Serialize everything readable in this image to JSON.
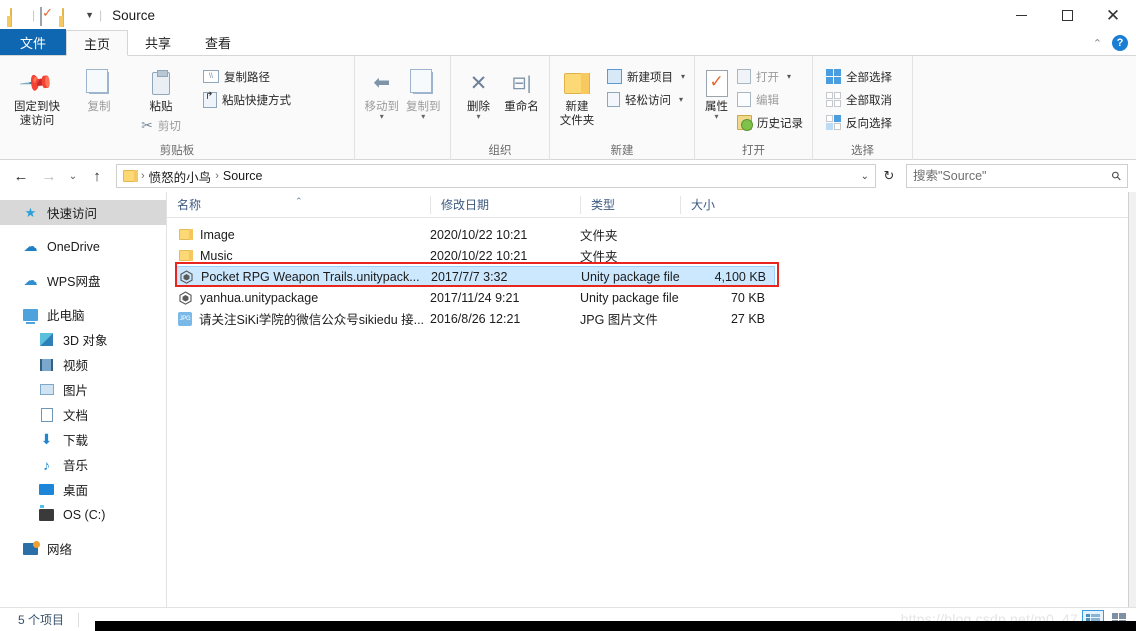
{
  "window": {
    "title": "Source",
    "quick_access": [
      "folder-icon",
      "properties-icon",
      "new-folder-icon",
      "customize-caret"
    ],
    "controls": {
      "minimize": "—",
      "maximize": "□",
      "close": "✕"
    }
  },
  "tabs": [
    {
      "id": "file",
      "label": "文件"
    },
    {
      "id": "home",
      "label": "主页"
    },
    {
      "id": "share",
      "label": "共享"
    },
    {
      "id": "view",
      "label": "查看"
    }
  ],
  "tab_right": {
    "collapse": "⌃",
    "help": "?"
  },
  "ribbon": {
    "groups": [
      {
        "label": "剪贴板",
        "big": [
          {
            "label": "固定到快\n速访问",
            "icon": "pin-icon"
          },
          {
            "label": "复制",
            "icon": "copy-icon"
          },
          {
            "label": "粘贴",
            "icon": "paste-icon"
          }
        ],
        "cut_label": "剪切",
        "small": [
          {
            "label": "复制路径",
            "icon": "copy-path-icon"
          },
          {
            "label": "粘贴快捷方式",
            "icon": "paste-shortcut-icon"
          }
        ]
      },
      {
        "label": "组织",
        "big": [
          {
            "label": "移动到",
            "icon": "move-to-icon"
          },
          {
            "label": "复制到",
            "icon": "copy-to-icon"
          },
          {
            "label": "删除",
            "icon": "delete-icon"
          },
          {
            "label": "重命名",
            "icon": "rename-icon"
          }
        ]
      },
      {
        "label": "新建",
        "big": [
          {
            "label": "新建\n文件夹",
            "icon": "new-folder-icon"
          }
        ],
        "small": [
          {
            "label": "新建项目",
            "icon": "new-item-icon",
            "caret": "▾"
          },
          {
            "label": "轻松访问",
            "icon": "easy-access-icon",
            "caret": "▾"
          }
        ]
      },
      {
        "label": "打开",
        "big": [
          {
            "label": "属性",
            "icon": "properties-icon",
            "caret": "▾"
          }
        ],
        "small": [
          {
            "label": "打开",
            "icon": "open-icon",
            "caret": "▾"
          },
          {
            "label": "编辑",
            "icon": "edit-icon"
          },
          {
            "label": "历史记录",
            "icon": "history-icon"
          }
        ]
      },
      {
        "label": "选择",
        "small": [
          {
            "label": "全部选择",
            "icon": "select-all-icon"
          },
          {
            "label": "全部取消",
            "icon": "select-none-icon"
          },
          {
            "label": "反向选择",
            "icon": "invert-selection-icon"
          }
        ]
      }
    ]
  },
  "addressbar": {
    "back": "←",
    "forward": "→",
    "recent": "⌄",
    "up": "↑",
    "breadcrumb": [
      "愤怒的小鸟",
      "Source"
    ],
    "separator": "›",
    "dropdown": "⌄",
    "refresh": "↻",
    "search_placeholder": "搜索\"Source\"",
    "search_value": ""
  },
  "sidebar": {
    "items": [
      {
        "label": "快速访问",
        "icon": "star-icon",
        "selected": true,
        "indent": 0
      },
      {
        "label": "OneDrive",
        "icon": "onedrive-cloud-icon",
        "indent": 0,
        "gap": true
      },
      {
        "label": "WPS网盘",
        "icon": "wps-cloud-icon",
        "indent": 0,
        "gap": true
      },
      {
        "label": "此电脑",
        "icon": "this-pc-icon",
        "indent": 0,
        "gap": true
      },
      {
        "label": "3D 对象",
        "icon": "3d-objects-icon",
        "indent": 1
      },
      {
        "label": "视频",
        "icon": "videos-icon",
        "indent": 1
      },
      {
        "label": "图片",
        "icon": "pictures-icon",
        "indent": 1
      },
      {
        "label": "文档",
        "icon": "documents-icon",
        "indent": 1
      },
      {
        "label": "下载",
        "icon": "downloads-icon",
        "indent": 1
      },
      {
        "label": "音乐",
        "icon": "music-icon",
        "indent": 1
      },
      {
        "label": "桌面",
        "icon": "desktop-icon",
        "indent": 1
      },
      {
        "label": "OS (C:)",
        "icon": "drive-icon",
        "indent": 1
      },
      {
        "label": "网络",
        "icon": "network-icon",
        "indent": 0,
        "gap": true
      }
    ]
  },
  "filelist": {
    "columns": [
      {
        "label": "名称",
        "sorted": "asc"
      },
      {
        "label": "修改日期"
      },
      {
        "label": "类型"
      },
      {
        "label": "大小"
      }
    ],
    "rows": [
      {
        "name": "Image",
        "icon": "folder-icon",
        "date": "2020/10/22 10:21",
        "type": "文件夹",
        "size": "",
        "selected": false
      },
      {
        "name": "Music",
        "icon": "folder-icon",
        "date": "2020/10/22 10:21",
        "type": "文件夹",
        "size": "",
        "selected": false
      },
      {
        "name": "Pocket RPG Weapon Trails.unitypack...",
        "icon": "unity-package-icon",
        "date": "2017/7/7 3:32",
        "type": "Unity package file",
        "size": "4,100 KB",
        "selected": true
      },
      {
        "name": "yanhua.unitypackage",
        "icon": "unity-package-icon",
        "date": "2017/11/24 9:21",
        "type": "Unity package file",
        "size": "70 KB",
        "selected": false
      },
      {
        "name": "请关注SiKi学院的微信公众号sikiedu 接...",
        "icon": "jpg-file-icon",
        "date": "2016/8/26 12:21",
        "type": "JPG 图片文件",
        "size": "27 KB",
        "selected": false
      }
    ]
  },
  "statusbar": {
    "item_count": "5 个项目",
    "watermark": "https://blog.csdn.net/m0_47",
    "views": [
      {
        "name": "details-view",
        "active": true
      },
      {
        "name": "large-icons-view",
        "active": false
      }
    ]
  },
  "colors": {
    "file_tab_blue": "#0f67b1",
    "selection_blue": "#cce8ff",
    "annotation_red": "#e8251f",
    "folder_yellow": "#fcd975"
  }
}
